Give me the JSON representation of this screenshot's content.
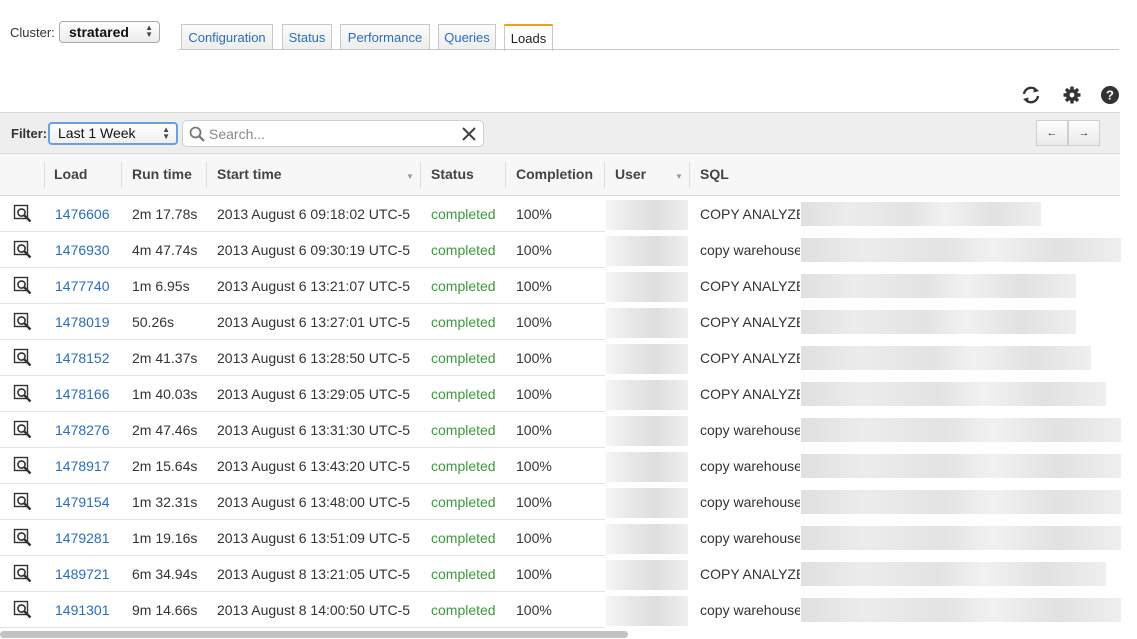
{
  "header": {
    "cluster_label": "Cluster:",
    "cluster_value": "stratared",
    "tabs": [
      {
        "label": "Configuration"
      },
      {
        "label": "Status"
      },
      {
        "label": "Performance"
      },
      {
        "label": "Queries"
      },
      {
        "label": "Loads"
      }
    ],
    "active_tab": "Loads"
  },
  "toolbar": {
    "icons": [
      "refresh-icon",
      "gear-icon",
      "help-icon"
    ]
  },
  "filter": {
    "label": "Filter:",
    "value": "Last 1 Week",
    "search_placeholder": "Search...",
    "prev_label": "←",
    "next_label": "→"
  },
  "table": {
    "columns": [
      "Load",
      "Run time",
      "Start time",
      "Status",
      "Completion",
      "User",
      "SQL"
    ],
    "rows": [
      {
        "load": "1476606",
        "run_time": "2m 17.78s",
        "start_time": "2013 August 6 09:18:02 UTC-5",
        "status": "completed",
        "completion": "100%",
        "sql": "COPY ANALYZE"
      },
      {
        "load": "1476930",
        "run_time": "4m 47.74s",
        "start_time": "2013 August 6 09:30:19 UTC-5",
        "status": "completed",
        "completion": "100%",
        "sql": "copy warehouse"
      },
      {
        "load": "1477740",
        "run_time": "1m 6.95s",
        "start_time": "2013 August 6 13:21:07 UTC-5",
        "status": "completed",
        "completion": "100%",
        "sql": "COPY ANALYZE"
      },
      {
        "load": "1478019",
        "run_time": "50.26s",
        "start_time": "2013 August 6 13:27:01 UTC-5",
        "status": "completed",
        "completion": "100%",
        "sql": "COPY ANALYZE"
      },
      {
        "load": "1478152",
        "run_time": "2m 41.37s",
        "start_time": "2013 August 6 13:28:50 UTC-5",
        "status": "completed",
        "completion": "100%",
        "sql": "COPY ANALYZE"
      },
      {
        "load": "1478166",
        "run_time": "1m 40.03s",
        "start_time": "2013 August 6 13:29:05 UTC-5",
        "status": "completed",
        "completion": "100%",
        "sql": "COPY ANALYZE"
      },
      {
        "load": "1478276",
        "run_time": "2m 47.46s",
        "start_time": "2013 August 6 13:31:30 UTC-5",
        "status": "completed",
        "completion": "100%",
        "sql": "copy warehouse"
      },
      {
        "load": "1478917",
        "run_time": "2m 15.64s",
        "start_time": "2013 August 6 13:43:20 UTC-5",
        "status": "completed",
        "completion": "100%",
        "sql": "copy warehouse"
      },
      {
        "load": "1479154",
        "run_time": "1m 32.31s",
        "start_time": "2013 August 6 13:48:00 UTC-5",
        "status": "completed",
        "completion": "100%",
        "sql": "copy warehouse"
      },
      {
        "load": "1479281",
        "run_time": "1m 19.16s",
        "start_time": "2013 August 6 13:51:09 UTC-5",
        "status": "completed",
        "completion": "100%",
        "sql": "copy warehouse"
      },
      {
        "load": "1489721",
        "run_time": "6m 34.94s",
        "start_time": "2013 August 8 13:21:05 UTC-5",
        "status": "completed",
        "completion": "100%",
        "sql": "COPY ANALYZE"
      },
      {
        "load": "1491301",
        "run_time": "9m 14.66s",
        "start_time": "2013 August 8 14:00:50 UTC-5",
        "status": "completed",
        "completion": "100%",
        "sql": "copy warehouse"
      }
    ]
  },
  "colors": {
    "link": "#2a6ebb",
    "status_completed": "#3a9a3a",
    "active_tab_accent": "#f0a020"
  }
}
